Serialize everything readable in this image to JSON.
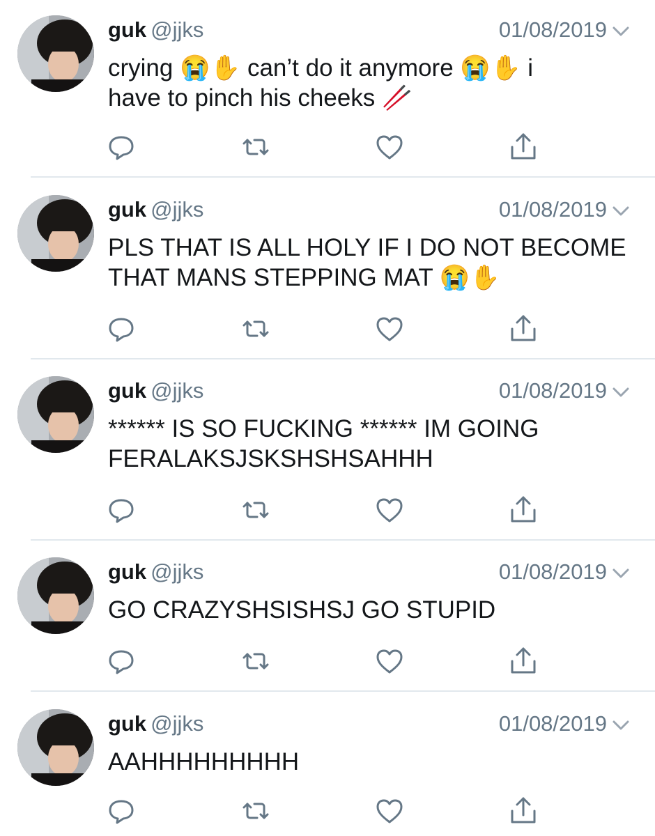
{
  "tweets": [
    {
      "name": "guk",
      "handle": "@jjks",
      "date": "01/08/2019",
      "text": "crying 😭✋ can’t do it anymore 😭✋ i\nhave to pinch his cheeks 🥢"
    },
    {
      "name": "guk",
      "handle": "@jjks",
      "date": "01/08/2019",
      "text": "PLS THAT IS ALL HOLY IF I DO NOT BECOME\nTHAT MANS STEPPING MAT 😭✋"
    },
    {
      "name": "guk",
      "handle": "@jjks",
      "date": "01/08/2019",
      "text": "****** IS SO FUCKING ****** IM GOING\nFERALAKSJSKSHSHSAHHH"
    },
    {
      "name": "guk",
      "handle": "@jjks",
      "date": "01/08/2019",
      "text": "GO CRAZYSHSISHSJ GO STUPID"
    },
    {
      "name": "guk",
      "handle": "@jjks",
      "date": "01/08/2019",
      "text": "AAHHHHHHHHH"
    }
  ],
  "colors": {
    "text": "#14171a",
    "secondary": "#657786",
    "icon": "#657786",
    "divider": "#e1e8ed"
  },
  "icons": {
    "reply": "reply-icon",
    "retweet": "retweet-icon",
    "like": "like-icon",
    "share": "share-icon",
    "menu": "chevron-down-icon"
  }
}
